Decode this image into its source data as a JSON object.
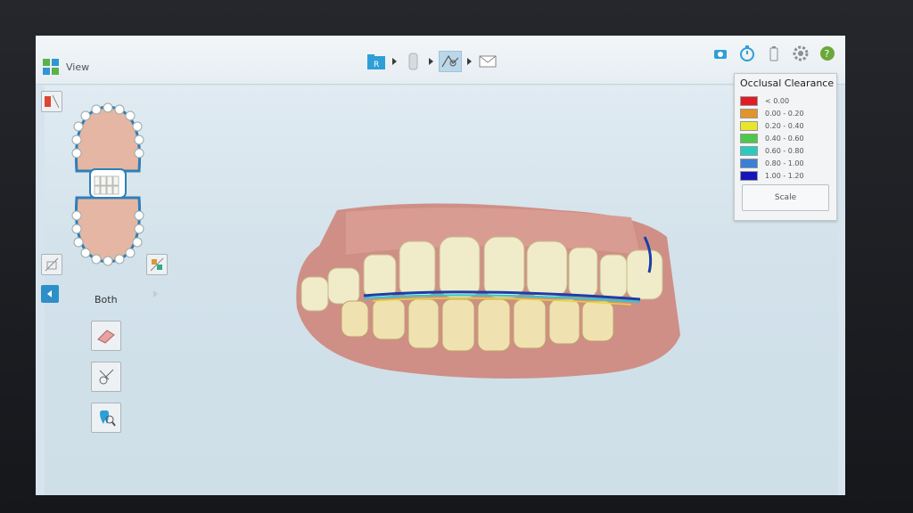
{
  "app": {
    "title": "View"
  },
  "workflow": {
    "steps": [
      {
        "name": "patient-info",
        "label": "R",
        "active": false
      },
      {
        "name": "scan",
        "label": "",
        "active": false
      },
      {
        "name": "view",
        "label": "",
        "active": true
      },
      {
        "name": "send",
        "label": "",
        "active": false
      }
    ]
  },
  "toolbar_right": [
    "camera-icon",
    "timer-icon",
    "battery-icon",
    "settings-icon",
    "help-icon"
  ],
  "left_panel": {
    "view_label": "Both",
    "tools": [
      "eraser-tool-icon",
      "trim-tool-icon",
      "tooth-search-icon"
    ]
  },
  "legend": {
    "title": "Occlusal Clearance",
    "items": [
      {
        "color": "#e01c24",
        "label": "< 0.00"
      },
      {
        "color": "#e0952a",
        "label": "0.00 - 0.20"
      },
      {
        "color": "#e9e52b",
        "label": "0.20 - 0.40"
      },
      {
        "color": "#4dc84a",
        "label": "0.40 - 0.60"
      },
      {
        "color": "#2cc9c0",
        "label": "0.60 - 0.80"
      },
      {
        "color": "#3b7fd6",
        "label": "0.80 - 1.00"
      },
      {
        "color": "#1616b8",
        "label": "1.00 - 1.20"
      }
    ],
    "scale_button": "Scale"
  },
  "colors": {
    "accent": "#2e9fd6",
    "background": "#d7e4ed",
    "help": "#6aa83a"
  }
}
